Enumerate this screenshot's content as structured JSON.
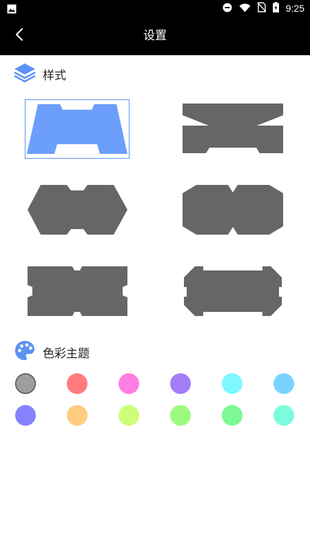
{
  "status_bar": {
    "time": "9:25",
    "icons": [
      "image-icon",
      "dnd-icon",
      "wifi-icon",
      "no-sim-icon",
      "battery-icon"
    ]
  },
  "app_bar": {
    "title": "设置",
    "back_icon": "chevron-left-icon"
  },
  "sections": {
    "style": {
      "label": "样式",
      "icon": "layers-icon"
    },
    "theme": {
      "label": "色彩主题",
      "icon": "palette-icon"
    }
  },
  "style_options": {
    "selected_index": 0,
    "count": 6,
    "selected_color": "#6c9efb",
    "default_color": "#666666"
  },
  "theme_colors": [
    "#9e9e9e",
    "#ff7a7a",
    "#ff7ee3",
    "#a47df8",
    "#7ef8ff",
    "#7ad3ff",
    "#8482ff",
    "#ffcc80",
    "#ccff77",
    "#9cfb7e",
    "#7cf894",
    "#7cfcdc"
  ],
  "selected_color_index": 0
}
